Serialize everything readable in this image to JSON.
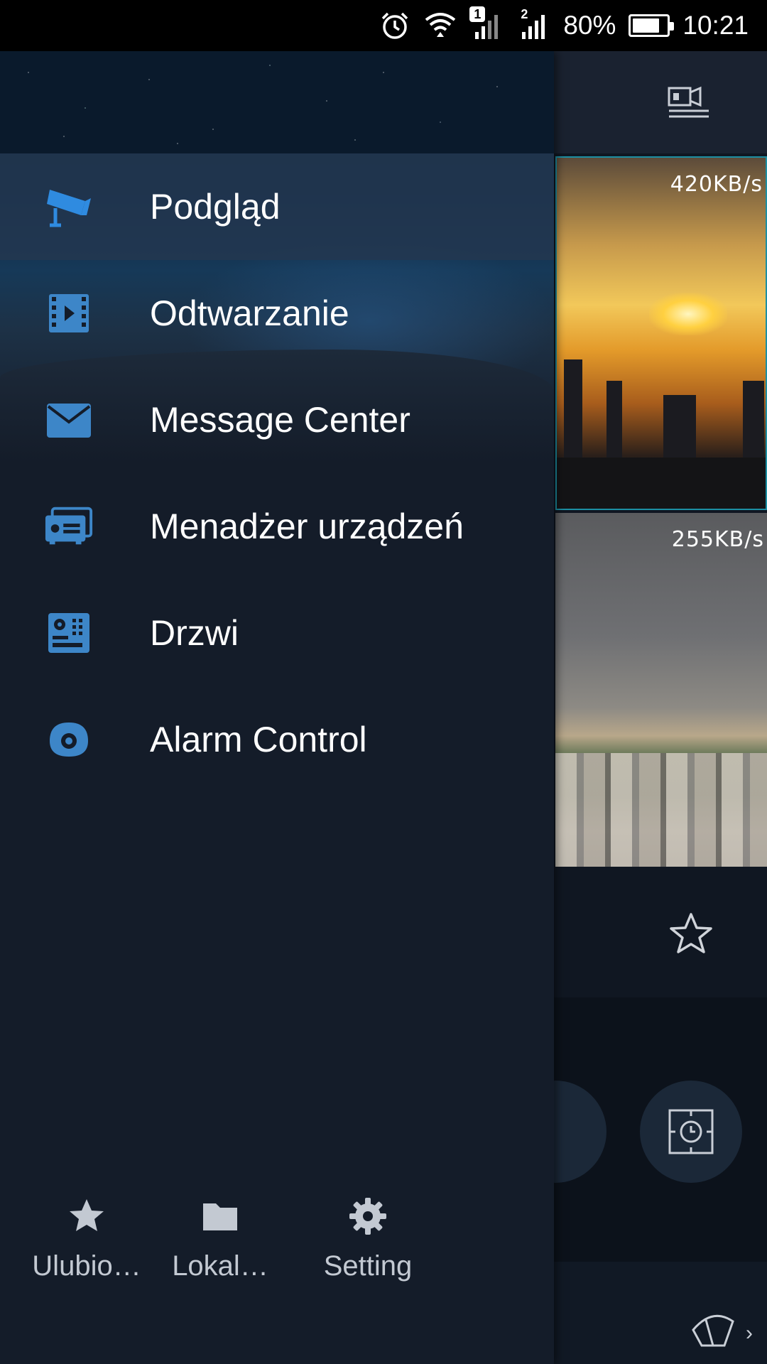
{
  "status_bar": {
    "icons": [
      "alarm-clock-icon",
      "wifi-icon",
      "signal-1-icon",
      "signal-2-icon",
      "battery-icon"
    ],
    "sim1_badge": "1",
    "sim2_badge": "2",
    "battery": "80%",
    "battery_level": 0.8,
    "time": "10:21"
  },
  "background_app": {
    "feeds": [
      {
        "rate": "420KB/s"
      },
      {
        "rate": "255KB/s"
      }
    ],
    "icons": [
      "camera-list-icon",
      "star-icon",
      "playback-clock-icon",
      "wiper-icon",
      "chevron-right-icon"
    ]
  },
  "drawer": {
    "menu": [
      {
        "label": "Podgląd",
        "icon": "cctv-camera-icon",
        "active": true
      },
      {
        "label": "Odtwarzanie",
        "icon": "film-play-icon",
        "active": false
      },
      {
        "label": "Message Center",
        "icon": "envelope-icon",
        "active": false
      },
      {
        "label": "Menadżer urządzeń",
        "icon": "dvr-device-icon",
        "active": false
      },
      {
        "label": "Drzwi",
        "icon": "door-intercom-icon",
        "active": false
      },
      {
        "label": "Alarm Control",
        "icon": "alarm-sensor-icon",
        "active": false
      }
    ],
    "bottom_nav": [
      {
        "label": "Ulubio…",
        "icon": "star-icon"
      },
      {
        "label": "Lokal…",
        "icon": "folder-icon"
      },
      {
        "label": "Setting",
        "icon": "gear-icon"
      }
    ]
  },
  "colors": {
    "accent": "#2f8be0",
    "icon_blue": "#3d86c8",
    "drawer_bg": "#141c29",
    "active_row": "#233750"
  }
}
